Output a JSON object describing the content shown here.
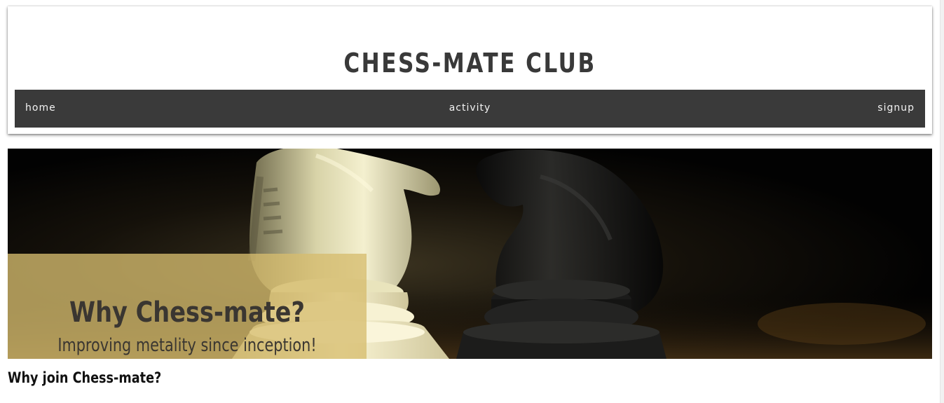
{
  "header": {
    "title": "CHESS-MATE CLUB"
  },
  "nav": {
    "home": "home",
    "activity": "activity",
    "signup": "signup"
  },
  "hero": {
    "image_subject": "white and black chess knights",
    "heading": "Why Chess-mate?",
    "subheading": "Improving metality since inception!"
  },
  "content": {
    "section_heading": "Why join Chess-mate?"
  },
  "colors": {
    "nav_background": "#3a3a3a",
    "title_text": "#393939",
    "caption_overlay": "#d6bc6e"
  }
}
